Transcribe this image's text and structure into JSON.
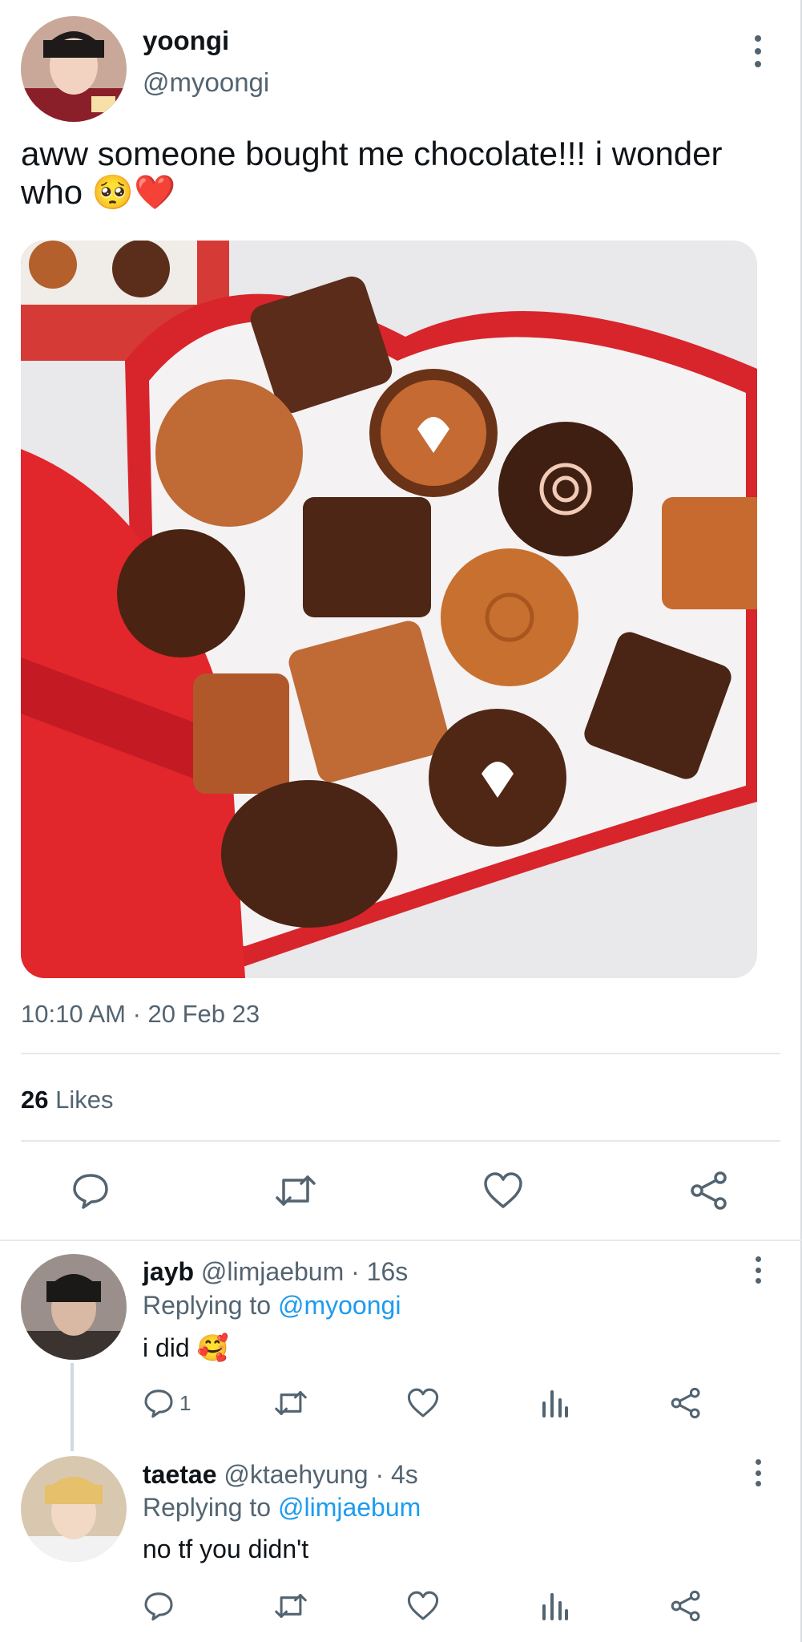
{
  "tweet": {
    "author_name": "yoongi",
    "author_handle": "@myoongi",
    "text": "aww someone bought me chocolate!!! i wonder who 🥺❤️",
    "timestamp": "10:10 AM · 20 Feb 23",
    "likes_count": "26",
    "likes_label": "Likes"
  },
  "replies": [
    {
      "name": "jayb",
      "handle": "@limjaebum",
      "time": "· 16s",
      "replying_prefix": "Replying to",
      "replying_to": "@myoongi",
      "text": "i did 🥰",
      "reply_count": "1"
    },
    {
      "name": "taetae",
      "handle": "@ktaehyung",
      "time": "· 4s",
      "replying_prefix": "Replying to",
      "replying_to": "@limjaebum",
      "text": "no tf you didn't",
      "reply_count": ""
    }
  ],
  "icons": {
    "reply": "reply-icon",
    "retweet": "retweet-icon",
    "like": "heart-icon",
    "share": "share-icon",
    "views": "analytics-icon",
    "more": "more-vertical-icon"
  },
  "colors": {
    "link": "#1d9bf0",
    "muted": "#536471",
    "text": "#0f1419",
    "divider": "#e6e9eb"
  }
}
